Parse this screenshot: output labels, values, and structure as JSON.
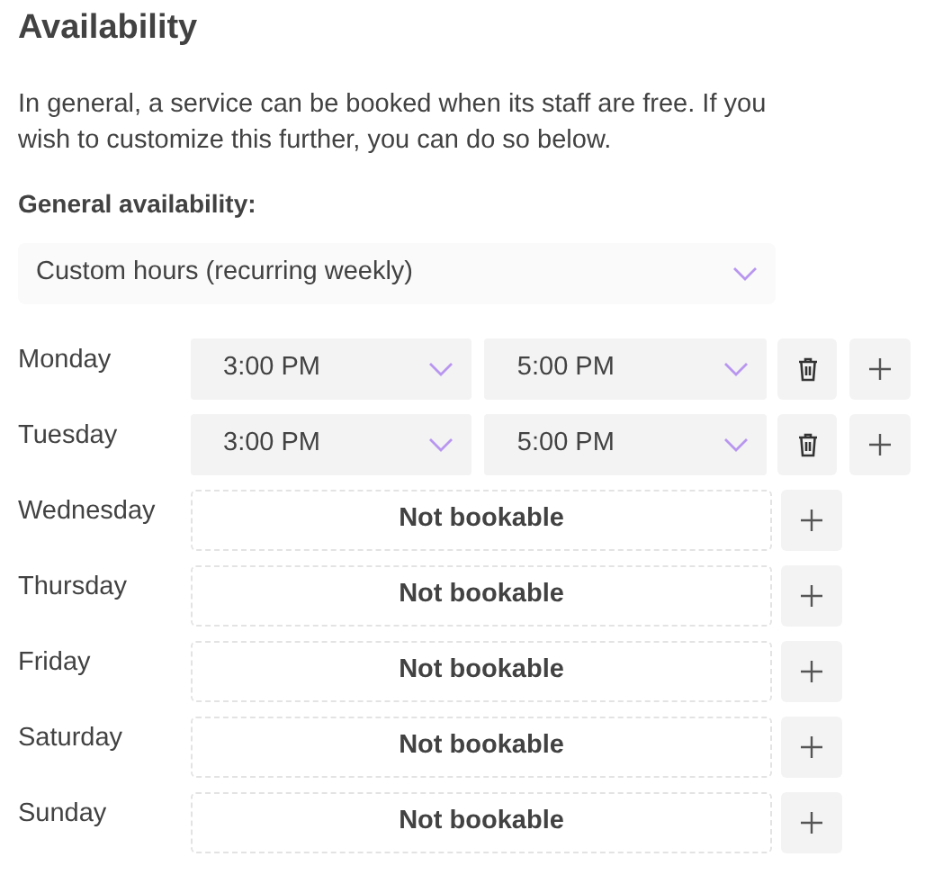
{
  "title": "Availability",
  "description": "In general, a service can be booked when its staff are free. If you wish to customize this further, you can do so below.",
  "general_availability": {
    "label": "General availability:",
    "value": "Custom hours (recurring weekly)"
  },
  "days": [
    {
      "day": "Monday",
      "kind": "hours",
      "start": "3:00 PM",
      "end": "5:00 PM"
    },
    {
      "day": "Tuesday",
      "kind": "hours",
      "start": "3:00 PM",
      "end": "5:00 PM"
    },
    {
      "day": "Wednesday",
      "kind": "not_bookable",
      "text": "Not bookable"
    },
    {
      "day": "Thursday",
      "kind": "not_bookable",
      "text": "Not bookable"
    },
    {
      "day": "Friday",
      "kind": "not_bookable",
      "text": "Not bookable"
    },
    {
      "day": "Saturday",
      "kind": "not_bookable",
      "text": "Not bookable"
    },
    {
      "day": "Sunday",
      "kind": "not_bookable",
      "text": "Not bookable"
    }
  ]
}
